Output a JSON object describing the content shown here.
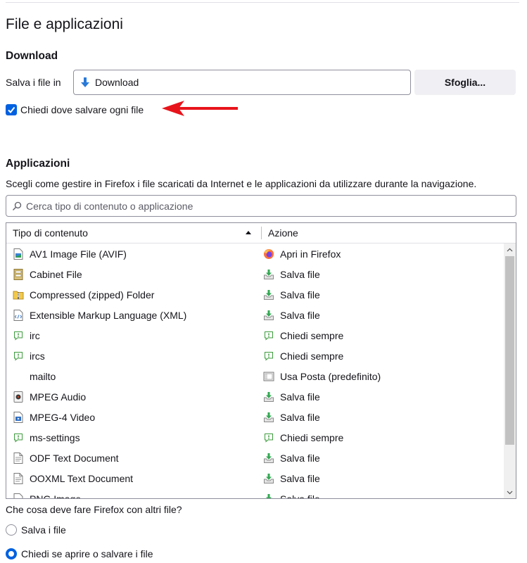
{
  "section": {
    "title": "File e applicazioni"
  },
  "download": {
    "heading": "Download",
    "save_label": "Salva i file in",
    "folder": "Download",
    "browse_label": "Sfoglia...",
    "ask_checkbox_label": "Chiedi dove salvare ogni file",
    "ask_checked": true,
    "annotation_arrow_color": "#e8141b"
  },
  "applications": {
    "heading": "Applicazioni",
    "description": "Scegli come gestire in Firefox i file scaricati da Internet e le applicazioni da utilizzare durante la navigazione.",
    "search_placeholder": "Cerca tipo di contenuto o applicazione",
    "columns": {
      "type": "Tipo di contenuto",
      "action": "Azione"
    },
    "rows": [
      {
        "type": "AV1 Image File (AVIF)",
        "type_icon": "image-file-icon",
        "action": "Apri in Firefox",
        "action_icon": "firefox-icon"
      },
      {
        "type": "Cabinet File",
        "type_icon": "cabinet-file-icon",
        "action": "Salva file",
        "action_icon": "save-file-icon"
      },
      {
        "type": "Compressed (zipped) Folder",
        "type_icon": "zip-folder-icon",
        "action": "Salva file",
        "action_icon": "save-file-icon"
      },
      {
        "type": "Extensible Markup Language (XML)",
        "type_icon": "xml-file-icon",
        "action": "Salva file",
        "action_icon": "save-file-icon"
      },
      {
        "type": "irc",
        "type_icon": "ask-icon",
        "action": "Chiedi sempre",
        "action_icon": "ask-icon"
      },
      {
        "type": "ircs",
        "type_icon": "ask-icon",
        "action": "Chiedi sempre",
        "action_icon": "ask-icon"
      },
      {
        "type": "mailto",
        "type_icon": "",
        "action": "Usa Posta (predefinito)",
        "action_icon": "mail-app-icon"
      },
      {
        "type": "MPEG Audio",
        "type_icon": "audio-file-icon",
        "action": "Salva file",
        "action_icon": "save-file-icon"
      },
      {
        "type": "MPEG-4 Video",
        "type_icon": "video-file-icon",
        "action": "Salva file",
        "action_icon": "save-file-icon"
      },
      {
        "type": "ms-settings",
        "type_icon": "ask-icon",
        "action": "Chiedi sempre",
        "action_icon": "ask-icon"
      },
      {
        "type": "ODF Text Document",
        "type_icon": "document-icon",
        "action": "Salva file",
        "action_icon": "save-file-icon"
      },
      {
        "type": "OOXML Text Document",
        "type_icon": "document-icon",
        "action": "Salva file",
        "action_icon": "save-file-icon"
      },
      {
        "type": "PNG Image",
        "type_icon": "image-file-icon",
        "action": "Salva file",
        "action_icon": "save-file-icon"
      }
    ]
  },
  "other_files": {
    "question": "Che cosa deve fare Firefox con altri file?",
    "options": [
      {
        "label": "Salva i file",
        "checked": false
      },
      {
        "label": "Chiedi se aprire o salvare i file",
        "checked": true
      }
    ]
  },
  "colors": {
    "accent": "#0061e0",
    "button_bg": "#f0f0f4",
    "border": "#8f8f9d"
  }
}
